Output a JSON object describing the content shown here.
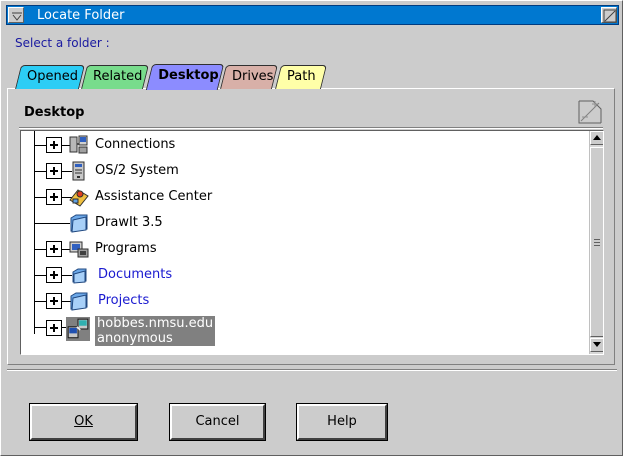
{
  "window": {
    "title": "Locate Folder",
    "prompt": "Select a folder :"
  },
  "tabs": [
    {
      "label": "Opened",
      "color": "#2ccdf5"
    },
    {
      "label": "Related",
      "color": "#78dc8c"
    },
    {
      "label": "Desktop",
      "color": "#8c8cff",
      "selected": true
    },
    {
      "label": "Drives",
      "color": "#d8b0a8"
    },
    {
      "label": "Path",
      "color": "#ffffa8"
    }
  ],
  "page": {
    "title": "Desktop"
  },
  "tree": {
    "items": [
      {
        "label": "Connections",
        "icon": "connections-icon",
        "expandable": true
      },
      {
        "label": "OS/2 System",
        "icon": "os2-system-icon",
        "expandable": true
      },
      {
        "label": "Assistance Center",
        "icon": "assistance-center-icon",
        "expandable": true
      },
      {
        "label": "DrawIt 3.5",
        "icon": "folder-icon",
        "expandable": false
      },
      {
        "label": "Programs",
        "icon": "programs-icon",
        "expandable": true
      },
      {
        "label": "Documents",
        "icon": "folder-icon",
        "expandable": true
      },
      {
        "label": "Projects",
        "icon": "folder-icon",
        "expandable": true
      },
      {
        "label_line1": "hobbes.nmsu.edu",
        "label_line2": "anonymous",
        "icon": "ftp-site-icon",
        "expandable": true,
        "selected": true
      }
    ]
  },
  "buttons": {
    "ok": "OK",
    "cancel": "Cancel",
    "help": "Help"
  }
}
